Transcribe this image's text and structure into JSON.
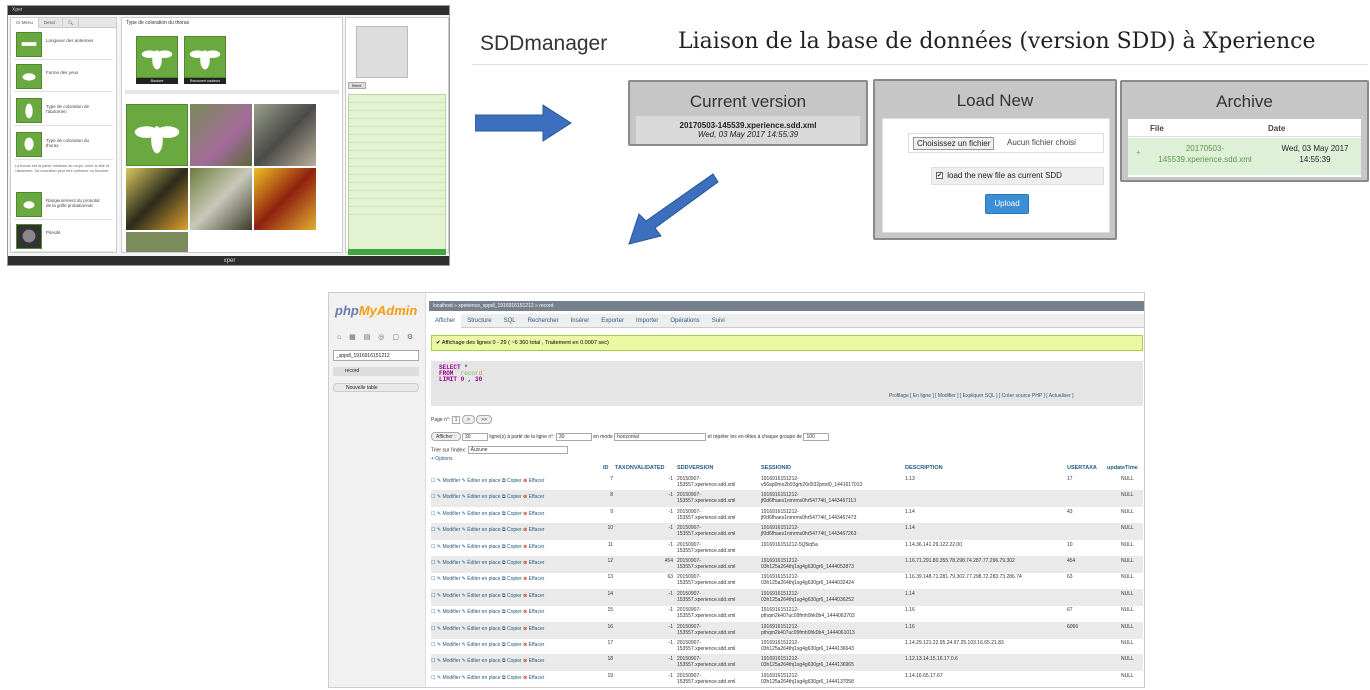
{
  "xper": {
    "topbar": "Xper",
    "tabs": [
      "Cl-Menu",
      "Descr.",
      "🔍"
    ],
    "left_items": [
      "Longueur des antennes",
      "Forme des yeux",
      "Type de coloration de l'abdomen",
      "Type de coloration du thorax",
      "Rangeurement du pronotal de la grille probationnal",
      "Pilosité"
    ],
    "main_title": "Type de coloration du thorax",
    "image_labels": [
      "Bicolore",
      "Recouvert couleurs"
    ],
    "right_button": "Reinit.",
    "footer": "xper"
  },
  "header": {
    "app_name": "SDDmanager",
    "heading": "Liaison de la base de données (version SDD) à Xperience"
  },
  "current": {
    "title": "Current version",
    "file": "20170503-145539.xperience.sdd.xml",
    "date": "Wed, 03 May 2017 14:55:39"
  },
  "load": {
    "title": "Load New",
    "choose_label": "Choisissez un fichier",
    "no_file": "Aucun fichier choisi",
    "checkbox_label": "load the new file as current SDD",
    "checked_mark": "✔",
    "upload_label": "Upload"
  },
  "archive": {
    "title": "Archive",
    "col_file": "File",
    "col_date": "Date",
    "row_icon": "+",
    "row_file": "20170503-145539.xperience.sdd.xml",
    "row_date": "Wed, 03 May 2017 14:55:39"
  },
  "pma": {
    "logo_a": "php",
    "logo_b": "MyAdmin",
    "db_select": "_sppdl_1916916151212",
    "table_name": "record",
    "new_table": "Nouvelle table",
    "breadcrumb": "localhost » xperience_sppdl_1916916151212 » record",
    "tabs": [
      "Afficher",
      "Structure",
      "SQL",
      "Rechercher",
      "Insérer",
      "Exporter",
      "Importer",
      "Opérations",
      "Suivi"
    ],
    "success": "✔ Affichage des lignes 0 - 29 ( ~6 360 total , Traitement en 0.0007 sec)",
    "sql_select": "SELECT *",
    "sql_from": "FROM",
    "sql_table": "`record`",
    "sql_limit": "LIMIT 0 , 30",
    "links": "Profilage [ En ligne ] [ Modifier ] [ Expliquer SQL ] [ Créer source PHP ] [ Actualiser ]",
    "nav_page": "Page n°:",
    "nav_page_val": "1",
    "nav_show": "Afficher :",
    "nav_rows": "30",
    "nav_from_label": "ligne(s) à partir de la ligne n°:",
    "nav_from": "30",
    "nav_mode_label": "en mode",
    "nav_mode": "horizontal",
    "nav_repeat": "et répéter les en-têtes à chaque groupe de",
    "nav_repeat_val": "100",
    "sort_label": "Trier sur l'index:",
    "sort_val": "Aucune",
    "options": "+ Options",
    "headers": [
      "ID",
      "TAXONVALIDATED",
      "SDDVERSION",
      "SESSIONID",
      "DESCRIPTION",
      "USERTAXA",
      "updateTime"
    ],
    "act_edit": "Modifier",
    "act_inline": "Éditer en place",
    "act_copy": "Copier",
    "act_delete": "Effacer",
    "rows": [
      {
        "id": "7",
        "tax": "-1",
        "sdd": "20150907-\n153557.xperience.sdd.xml",
        "sess": "1916916151212-\nv56ap0mo2b93gm26r0l32pmd0_1441617013",
        "desc": "1.13",
        "user": "17",
        "upd": "NULL"
      },
      {
        "id": "8",
        "tax": "-1",
        "sdd": "20150907-\n153557.xperience.sdd.xml",
        "sess": "1916916151212-\njf0d6fhaes1nmrms0hr54774tl_1443467113",
        "desc": "",
        "user": "",
        "upd": "NULL"
      },
      {
        "id": "9",
        "tax": "-1",
        "sdd": "20150907-\n153557.xperience.sdd.xml",
        "sess": "1916916151212-\njf0d6fhaes1nmrms0hr54774tl_1443467473",
        "desc": "1.14",
        "user": "43",
        "upd": "NULL"
      },
      {
        "id": "10",
        "tax": "-1",
        "sdd": "20150907-\n153557.xperience.sdd.xml",
        "sess": "1916916151212-\njf0d6fhaes1nmrms0hr54774tl_1443467263",
        "desc": "1.14",
        "user": "",
        "upd": "NULL"
      },
      {
        "id": "11",
        "tax": "-1",
        "sdd": "20150907-\n153557.xperience.sdd.xml",
        "sess": "1916916151212-5Q5iq5a",
        "desc": "1.14.36.141.29.122.22.00",
        "user": "10",
        "upd": "NULL"
      },
      {
        "id": "12",
        "tax": "454",
        "sdd": "20150907-\n153557.xperience.sdd.xml",
        "sess": "1916916151212-\n03h125a264thj1sg4g630gr6_1444052873",
        "desc": "1.16.71.291.80.355.78.298.74.287.77.296.79.302",
        "user": "454",
        "upd": "NULL"
      },
      {
        "id": "13",
        "tax": "63",
        "sdd": "20150907-\n153557.xperience.sdd.xml",
        "sess": "1916916151212-\n03h125a264thj1sg4g630gr6_1444032424",
        "desc": "1.16.39.148.71.281.79.302.77.298.72.283.73.286.74",
        "user": "63",
        "upd": "NULL"
      },
      {
        "id": "14",
        "tax": "-1",
        "sdd": "20150907-\n153557.xperience.sdd.xml",
        "sess": "1916916151212-\n03h125a264thj1sg4g630gr6_1444036252",
        "desc": "1.14",
        "user": "",
        "upd": "NULL"
      },
      {
        "id": "15",
        "tax": "-1",
        "sdd": "20150907-\n153557.xperience.sdd.xml",
        "sess": "1916916151212-\npthqm2k407uc09fmh0hk0b4_1444063703",
        "desc": "1.16",
        "user": "67",
        "upd": "NULL"
      },
      {
        "id": "16",
        "tax": "-1",
        "sdd": "20150907-\n153557.xperience.sdd.xml",
        "sess": "1916916151212-\npthqm2k407uc09fmh0hk0b4_1444061013",
        "desc": "1.16",
        "user": "6066",
        "upd": "NULL"
      },
      {
        "id": "17",
        "tax": "-1",
        "sdd": "20150907-\n153557.xperience.sdd.xml",
        "sess": "1916916151212-\n03h125a264thj1sg4g630gr6_1444136643",
        "desc": "1.14.29.121.22.95.24.97.25.103.16.65.21.83",
        "user": "",
        "upd": "NULL"
      },
      {
        "id": "18",
        "tax": "-1",
        "sdd": "20150907-\n153557.xperience.sdd.xml",
        "sess": "1916916151212-\n03h125a264thj1sg4g630gr6_1444136965",
        "desc": "1.12.13.14.15.16.17.0.6",
        "user": "",
        "upd": "NULL"
      },
      {
        "id": "19",
        "tax": "-1",
        "sdd": "20150907-\n153557.xperience.sdd.xml",
        "sess": "1916916151212-\n03h125a264thj1sg4g630gr6_1444137058",
        "desc": "1.14.16.65.17.67",
        "user": "",
        "upd": "NULL"
      }
    ]
  }
}
